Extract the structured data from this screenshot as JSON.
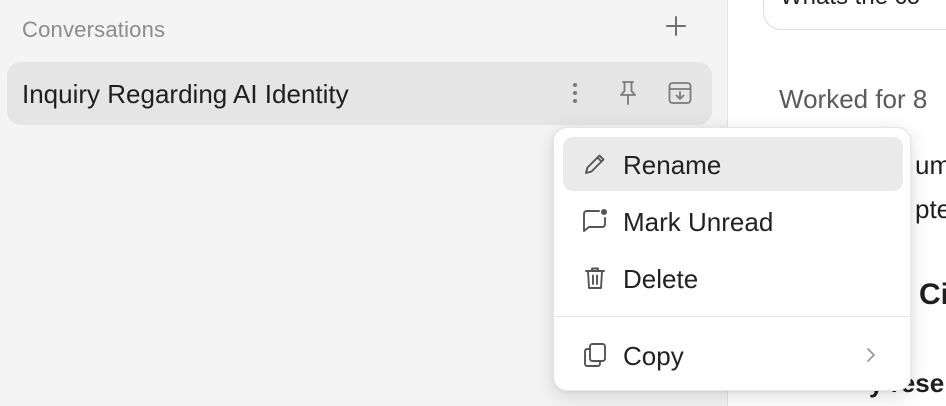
{
  "sidebar": {
    "header": "Conversations",
    "conversation": {
      "title": "Inquiry Regarding AI Identity"
    }
  },
  "main": {
    "prompt_fragment": "Whats the co",
    "worked_text": "Worked for 8",
    "fragments": [
      "um",
      "pter",
      "Ci",
      "y rese"
    ]
  },
  "context_menu": {
    "items": [
      {
        "label": "Rename",
        "icon": "pencil-icon"
      },
      {
        "label": "Mark Unread",
        "icon": "chat-unread-icon"
      },
      {
        "label": "Delete",
        "icon": "trash-icon"
      },
      {
        "label": "Copy",
        "icon": "copy-icon",
        "has_submenu": true
      }
    ]
  },
  "colors": {
    "sidebar_bg": "#f4f4f4",
    "selected_item_bg": "#e5e5e5",
    "menu_hover_bg": "#eaeaea",
    "icon_color": "#7a7a7a"
  }
}
